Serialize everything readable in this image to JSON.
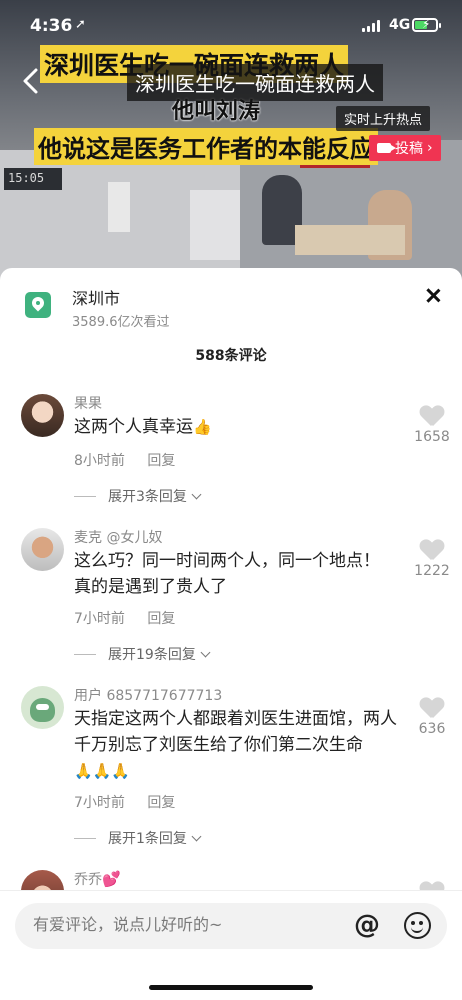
{
  "status_bar": {
    "time": "4:36",
    "location_arrow": "➚",
    "network": "4G"
  },
  "video": {
    "overlay_title": "深圳医生吃一碗面连救两人",
    "caption_top": "深圳医生吃一碗面连救两人",
    "caption_mid": "他叫刘涛",
    "caption_bottom": "他说这是医务工作者的本能反应",
    "clock_text": "15:05",
    "hot_tag": "实时上升热点",
    "submit_label": "投稿",
    "submit_chevron": "›"
  },
  "sheet": {
    "city": "深圳市",
    "views": "3589.6亿次看过",
    "comment_count": "588条评论"
  },
  "comments": [
    {
      "user": "果果",
      "text": "这两个人真幸运",
      "emoji": "👍",
      "time": "8小时前",
      "reply": "回复",
      "likes": "1658",
      "expand": "展开3条回复"
    },
    {
      "user": "麦克 @女儿奴",
      "text": "这么巧？同一时间两个人，同一个地点！真的是遇到了贵人了",
      "time": "7小时前",
      "reply": "回复",
      "likes": "1222",
      "expand": "展开19条回复"
    },
    {
      "user": "用户 6857717677713",
      "text": "天指定这两个人都跟着刘医生进面馆，两人千万别忘了刘医生给了你们第二次生命",
      "emoji": "🙏🙏🙏",
      "time": "7小时前",
      "reply": "回复",
      "likes": "636",
      "expand": "展开1条回复"
    },
    {
      "user": "乔乔",
      "emoji": "💕"
    }
  ],
  "input": {
    "placeholder": "有爱评论，说点儿好听的~",
    "value": "",
    "at_label": "@"
  },
  "colors": {
    "accent_red": "#f03452",
    "location_green": "#3fb27f",
    "caption_yellow": "#f4d33c"
  }
}
